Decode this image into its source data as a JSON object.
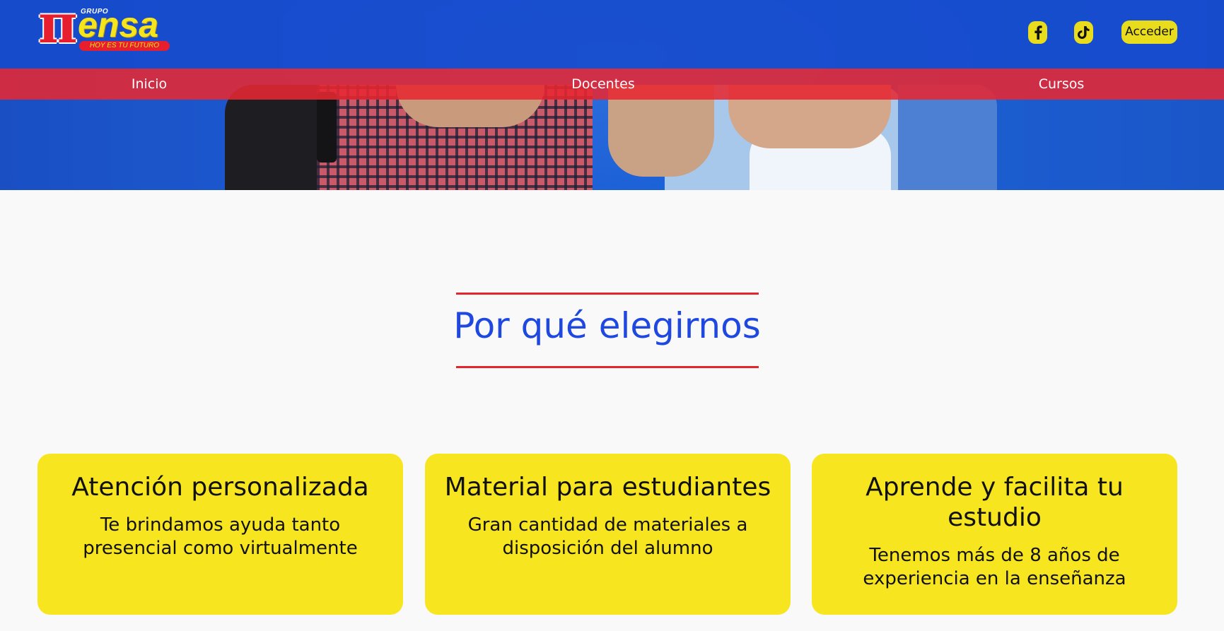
{
  "brand": {
    "logo_grupo": "GRUPO",
    "logo_pi": "π",
    "logo_name": "ensa",
    "logo_tagline": "HOY ES TU FUTURO"
  },
  "header": {
    "social": [
      {
        "icon": "facebook-icon"
      },
      {
        "icon": "tiktok-icon"
      }
    ],
    "acceder_label": "Acceder"
  },
  "nav": {
    "items": [
      {
        "label": "Inicio"
      },
      {
        "label": "Docentes"
      },
      {
        "label": "Cursos"
      }
    ]
  },
  "section": {
    "title": "Por qué elegirnos"
  },
  "features": [
    {
      "title": "Atención personalizada",
      "text": "Te brindamos ayuda tanto presencial como virtualmente"
    },
    {
      "title": "Material para estudiantes",
      "text": "Gran cantidad de materiales a disposición del alumno"
    },
    {
      "title": "Aprende y facilita tu estudio",
      "text": "Tenemos más de 8 años de experiencia en la enseñanza"
    }
  ],
  "colors": {
    "header_blue": "#164acd",
    "nav_red": "#e62832",
    "accent_yellow": "#f7e61f",
    "title_blue": "#1f48e0",
    "rule_red": "#e32630"
  }
}
